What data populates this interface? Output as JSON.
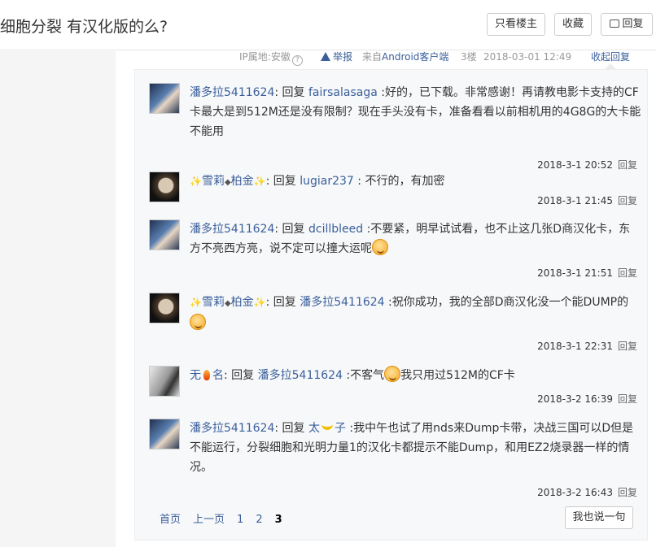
{
  "header": {
    "title": "细胞分裂 有汉化版的么?",
    "only_lz": "只看楼主",
    "favorite": "收藏",
    "reply": "回复"
  },
  "post_meta": {
    "ip": "IP属地:安徽",
    "help": "?",
    "report": "举报",
    "client_prefix": "来自",
    "client": "Android客户端",
    "floor": "3楼",
    "date": "2018-03-01 12:49",
    "collapse": "收起回复"
  },
  "replies": [
    {
      "user": "潘多拉5411624",
      "verb": ": 回复 ",
      "target": "fairsalasaga",
      "text": " :好的，已下载。非常感谢！再请教电影卡支持的CF卡最大是到512M还是没有限制？现在手头没有卡，准备看看以前相机用的4G8G的大卡能不能用",
      "time": "2018-3-1 20:52",
      "reply_btn": "回复"
    },
    {
      "user_pre": "✨",
      "user_a": "雪莉",
      "user_mid": "◆",
      "user_b": "柏金",
      "user_post": "✨",
      "verb": ": 回复 ",
      "target": "lugiar237",
      "text": " : 不行的，有加密",
      "time": "2018-3-1 21:45",
      "reply_btn": "回复"
    },
    {
      "user": "潘多拉5411624",
      "verb": ": 回复 ",
      "target": "dcillbleed",
      "text": " :不要紧，明早试试看，也不止这几张D商汉化卡，东方不亮西方亮，说不定可以撞大运呢",
      "time": "2018-3-1 21:51",
      "reply_btn": "回复"
    },
    {
      "user_pre": "✨",
      "user_a": "雪莉",
      "user_mid": "◆",
      "user_b": "柏金",
      "user_post": "✨",
      "verb": ": 回复 ",
      "target": "潘多拉5411624",
      "text": " :祝你成功，我的全部D商汉化没一个能DUMP的",
      "time": "2018-3-1 22:31",
      "reply_btn": "回复"
    },
    {
      "user_a": "无",
      "user_b": "名",
      "verb": ": 回复 ",
      "target": "潘多拉5411624",
      "text_a": " :不客气",
      "text_b": "我只用过512M的CF卡",
      "time": "2018-3-2 16:39",
      "reply_btn": "回复"
    },
    {
      "user": "潘多拉5411624",
      "verb": ": 回复 ",
      "target_a": "太",
      "target_b": "子",
      "text": " :我中午也试了用nds来Dump卡带，决战三国可以D但是不能运行，分裂细胞和光明力量1的汉化卡都提示不能Dump，和用EZ2烧录器一样的情况。",
      "time": "2018-3-2 16:43",
      "reply_btn": "回复"
    }
  ],
  "pager": {
    "first": "首页",
    "prev": "上一页",
    "pages": [
      "1",
      "2",
      "3"
    ],
    "current": "3"
  },
  "say_button": "我也说一句"
}
